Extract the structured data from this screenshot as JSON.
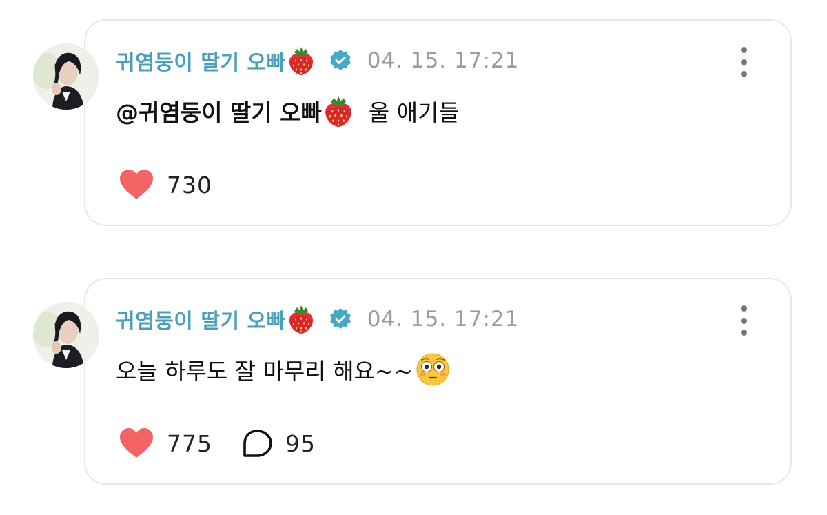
{
  "posts": [
    {
      "author": "귀염둥이 딸기 오빠",
      "verified": true,
      "timestamp": "04. 15. 17:21",
      "mention": "@귀염둥이 딸기 오빠",
      "text": "울 애기들",
      "trailing_emoji": "",
      "likes": "730",
      "comments": ""
    },
    {
      "author": "귀염둥이 딸기 오빠",
      "verified": true,
      "timestamp": "04. 15. 17:21",
      "mention": "",
      "text": "오늘 하루도 잘 마무리 해요~~",
      "trailing_emoji": "flushed-face",
      "likes": "775",
      "comments": "95"
    }
  ],
  "icons": {
    "author_emoji": "strawberry-icon",
    "verified": "verified-badge-icon",
    "more": "more-vertical-icon",
    "like": "heart-icon",
    "comment": "comment-bubble-icon"
  },
  "colors": {
    "author": "#4aa0b8",
    "verified": "#49a9c4",
    "timestamp": "#9a9ca1",
    "heart": "#f26466",
    "border": "#e7e7ea"
  }
}
